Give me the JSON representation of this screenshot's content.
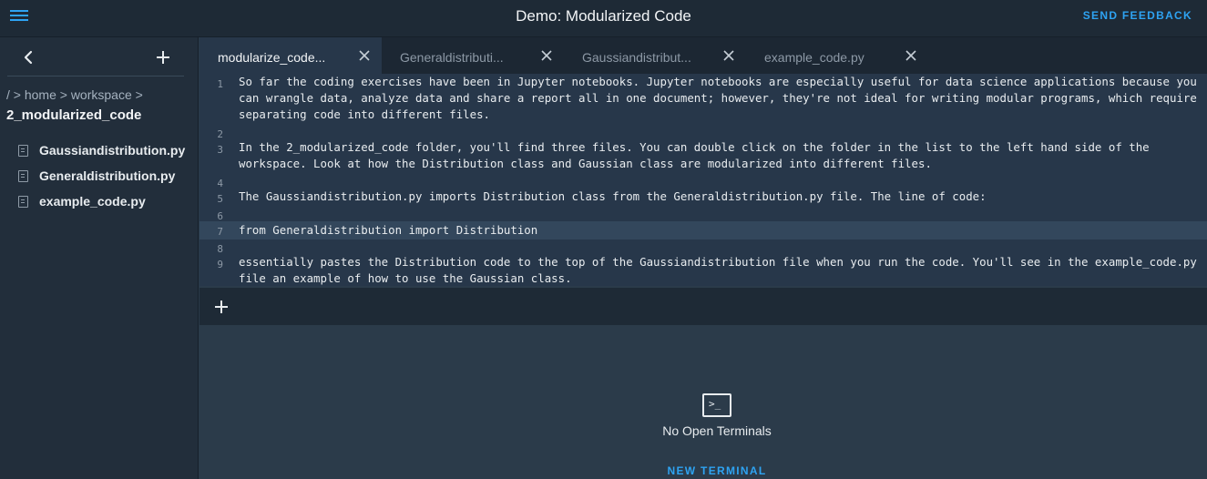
{
  "header": {
    "title": "Demo: Modularized Code",
    "send_feedback": "SEND FEEDBACK"
  },
  "sidebar": {
    "breadcrumb": "/ > home > workspace >",
    "current_folder": "2_modularized_code",
    "files": [
      {
        "name": "Gaussiandistribution.py",
        "icon": "file-icon"
      },
      {
        "name": "Generaldistribution.py",
        "icon": "file-icon"
      },
      {
        "name": "example_code.py",
        "icon": "file-icon"
      }
    ]
  },
  "tabs": [
    {
      "label": "modularize_code...",
      "active": true
    },
    {
      "label": "Generaldistributi...",
      "active": false
    },
    {
      "label": "Gaussiandistribut...",
      "active": false
    },
    {
      "label": "example_code.py",
      "active": false
    }
  ],
  "editor": {
    "lines": [
      {
        "number": "1",
        "text": "So far the coding exercises have been in Jupyter notebooks. Jupyter notebooks are especially useful for data science applications because you can wrangle data, analyze data and share a report all in one document; however, they're not ideal for writing modular programs, which require separating code into different files."
      },
      {
        "number": "2",
        "text": ""
      },
      {
        "number": "3",
        "text": "In the 2_modularized_code folder, you'll find three files. You can double click on the folder in the list to the left hand side of the workspace. Look at how the Distribution class and Gaussian class are modularized into different files."
      },
      {
        "number": "4",
        "text": ""
      },
      {
        "number": "5",
        "text": "The Gaussiandistribution.py imports Distribution class from the Generaldistribution.py file. The line of code:"
      },
      {
        "number": "6",
        "text": ""
      },
      {
        "number": "7",
        "text": "from Generaldistribution import Distribution"
      },
      {
        "number": "8",
        "text": ""
      },
      {
        "number": "9",
        "text": "essentially pastes the Distribution code to the top of the Gaussiandistribution file when you run the code. You'll see in the example_code.py file an example of how to use the Gaussian class."
      }
    ],
    "highlighted_line": "7"
  },
  "terminal": {
    "icon_glyph": ">_",
    "empty_message": "No Open Terminals",
    "new_terminal": "NEW TERMINAL"
  },
  "colors": {
    "accent": "#2ea3f2",
    "background": "#2b3b4a",
    "sidebar": "#222e3b",
    "editor": "#27374a"
  }
}
